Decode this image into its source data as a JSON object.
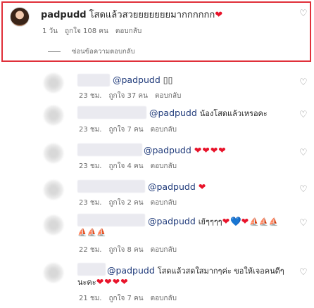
{
  "main_comment": {
    "username": "padpudd",
    "text": "โสดแล้วสวยยยยยยยมากกกกกก",
    "heart": "❤",
    "time": "1 วัน",
    "likes": "ถูกใจ 108 คน",
    "reply_label": "ตอบกลับ",
    "hide_replies": "ซ่อนข้อความตอบกลับ"
  },
  "replies": [
    {
      "mention": "@padpudd",
      "text": "▯▯",
      "time": "23 ชม.",
      "likes": "ถูกใจ 37 คน",
      "reply_label": "ตอบกลับ"
    },
    {
      "mention": "@padpudd",
      "text": "น้องโสดแล้วเหรอคะ",
      "time": "23 ชม.",
      "likes": "ถูกใจ 7 คน",
      "reply_label": "ตอบกลับ"
    },
    {
      "mention": "@padpudd",
      "text": "❤❤❤❤",
      "time": "23 ชม.",
      "likes": "ถูกใจ 4 คน",
      "reply_label": "ตอบกลับ"
    },
    {
      "mention": "@padpudd",
      "text": "❤",
      "time": "23 ชม.",
      "likes": "ถูกใจ 2 คน",
      "reply_label": "ตอบกลับ"
    },
    {
      "mention": "@padpudd",
      "text": "เย้ๆๆๆๆ",
      "text_hearts": "❤",
      "text_blue": "💙",
      "text_tail": "❤",
      "text_sails": "⛵⛵⛵",
      "text_line2": "⛵⛵⛵",
      "time": "22 ชม.",
      "likes": "ถูกใจ 8 คน",
      "reply_label": "ตอบกลับ"
    },
    {
      "mention": "@padpudd",
      "text": "โสดแล้วสดใสมากๆค่ะ ขอให้เจอคนดีๆ",
      "text_line2": "นะคะ",
      "text_hearts": "❤❤❤❤",
      "time": "21 ชม.",
      "likes": "ถูกใจ 7 คน",
      "reply_label": "ตอบกลับ"
    }
  ],
  "colors": {
    "highlight_border": "#e0303a",
    "heart": "#e8132a",
    "mention": "#1f3a7a"
  },
  "icons": {
    "like": "heart-outline-icon"
  }
}
